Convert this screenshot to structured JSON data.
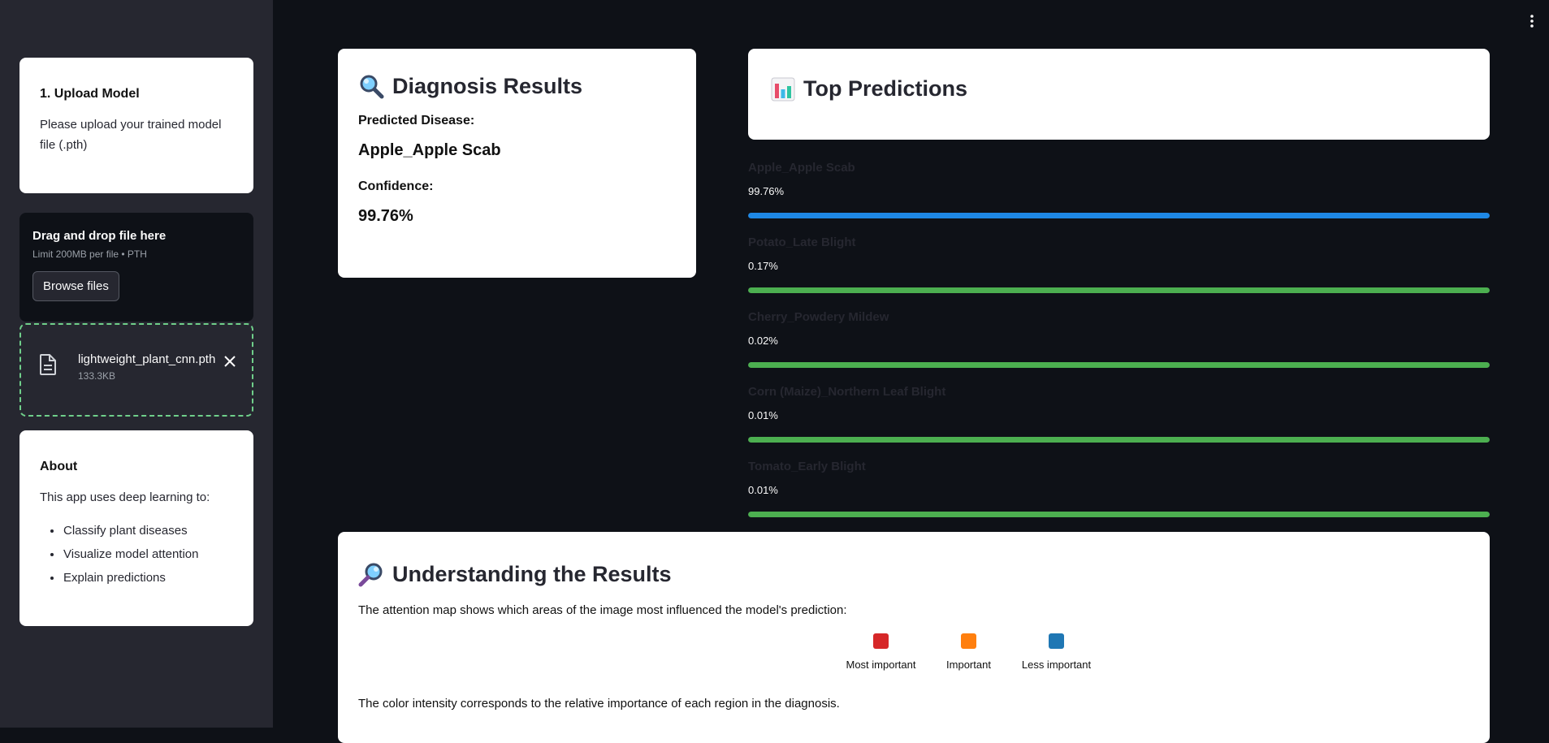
{
  "sidebar": {
    "upload_card": {
      "heading": "1. Upload Model",
      "text": "Please upload your trained model file (.pth)"
    },
    "uploader": {
      "title": "Drag and drop file here",
      "limit": "Limit 200MB per file • PTH",
      "browse_label": "Browse files"
    },
    "file": {
      "name": "lightweight_plant_cnn.pth",
      "size": "133.3KB",
      "icon": "file-icon",
      "close_icon": "close-icon"
    },
    "about": {
      "heading": "About",
      "text": "This app uses deep learning to:",
      "items": [
        "Classify plant diseases",
        "Visualize model attention",
        "Explain predictions"
      ]
    }
  },
  "main": {
    "menu_icon": "kebab-menu-icon",
    "diagnosis": {
      "title": "Diagnosis Results",
      "icon": "magnifier-icon",
      "predicted_label": "Predicted Disease:",
      "predicted_value": "Apple_Apple Scab",
      "confidence_label": "Confidence:",
      "confidence_value": "99.76%"
    },
    "top_predictions": {
      "title": "Top Predictions",
      "icon": "bar-chart-icon",
      "items": [
        {
          "name": "Apple_Apple Scab",
          "percent": "99.76%",
          "value": 0.9976,
          "color": "#1e88e5"
        },
        {
          "name": "Potato_Late Blight",
          "percent": "0.17%",
          "value": 0.0017,
          "color": "#4caf50"
        },
        {
          "name": "Cherry_Powdery Mildew",
          "percent": "0.02%",
          "value": 0.0002,
          "color": "#4caf50"
        },
        {
          "name": "Corn (Maize)_Northern Leaf Blight",
          "percent": "0.01%",
          "value": 0.0001,
          "color": "#4caf50"
        },
        {
          "name": "Tomato_Early Blight",
          "percent": "0.01%",
          "value": 0.0001,
          "color": "#4caf50"
        }
      ]
    },
    "understanding": {
      "title": "Understanding the Results",
      "icon": "magnifier-right-icon",
      "text": "The attention map shows which areas of the image most influenced the model's prediction:",
      "legend": [
        {
          "label": "Most important",
          "color": "#d62728"
        },
        {
          "label": "Important",
          "color": "#ff7f0e"
        },
        {
          "label": "Less important",
          "color": "#1f77b4"
        }
      ],
      "footer": "The color intensity corresponds to the relative importance of each region in the diagnosis."
    }
  }
}
